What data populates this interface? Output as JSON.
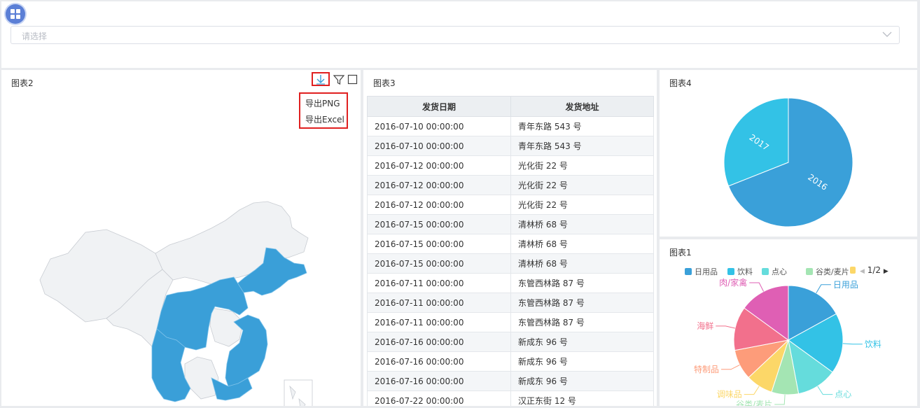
{
  "select": {
    "placeholder": "请选择"
  },
  "panels": {
    "map": {
      "title": "图表2",
      "export_menu": [
        "导出PNG",
        "导出Excel"
      ]
    },
    "table": {
      "title": "图表3",
      "columns": [
        "发货日期",
        "发货地址"
      ],
      "rows": [
        [
          "2016-07-10 00:00:00",
          "青年东路 543 号"
        ],
        [
          "2016-07-10 00:00:00",
          "青年东路 543 号"
        ],
        [
          "2016-07-12 00:00:00",
          "光化街 22 号"
        ],
        [
          "2016-07-12 00:00:00",
          "光化街 22 号"
        ],
        [
          "2016-07-12 00:00:00",
          "光化街 22 号"
        ],
        [
          "2016-07-15 00:00:00",
          "清林桥 68 号"
        ],
        [
          "2016-07-15 00:00:00",
          "清林桥 68 号"
        ],
        [
          "2016-07-15 00:00:00",
          "清林桥 68 号"
        ],
        [
          "2016-07-11 00:00:00",
          "东管西林路 87 号"
        ],
        [
          "2016-07-11 00:00:00",
          "东管西林路 87 号"
        ],
        [
          "2016-07-11 00:00:00",
          "东管西林路 87 号"
        ],
        [
          "2016-07-16 00:00:00",
          "新成东 96 号"
        ],
        [
          "2016-07-16 00:00:00",
          "新成东 96 号"
        ],
        [
          "2016-07-16 00:00:00",
          "新成东 96 号"
        ],
        [
          "2016-07-22 00:00:00",
          "汉正东街 12 号"
        ]
      ]
    },
    "pie_years": {
      "title": "图表4"
    },
    "pie_categories": {
      "title": "图表1",
      "pager": "1/2"
    }
  },
  "colors": {
    "accent": "#5b7fd6",
    "map_fill": "#3a9fd8",
    "map_empty": "#f0f2f4",
    "highlight_border": "#e02020"
  },
  "icons": [
    "grid-menu-icon",
    "chevron-down-icon",
    "download-icon",
    "filter-icon",
    "fullscreen-icon",
    "triangle-left-icon",
    "triangle-right-icon"
  ],
  "chart_data": [
    {
      "type": "pie",
      "labels": [
        "2016",
        "2017"
      ],
      "values": [
        69,
        31
      ],
      "colors": [
        "#3aa0d9",
        "#33c2e6"
      ],
      "label_position": "inside"
    },
    {
      "type": "pie",
      "labels": [
        "日用品",
        "饮料",
        "点心",
        "谷类/麦片",
        "调味品",
        "特制品",
        "海鲜",
        "肉/家禽"
      ],
      "values": [
        17,
        18,
        12,
        8,
        8,
        9,
        13,
        15
      ],
      "colors": [
        "#3aa0d9",
        "#33c2e6",
        "#65dcdc",
        "#a4e5b3",
        "#fcd768",
        "#fd9c7a",
        "#f2708c",
        "#df5fb4"
      ],
      "legend": {
        "visible_entries": [
          "日用品",
          "饮料",
          "点心",
          "谷类/麦片"
        ],
        "placement": "top"
      }
    }
  ]
}
